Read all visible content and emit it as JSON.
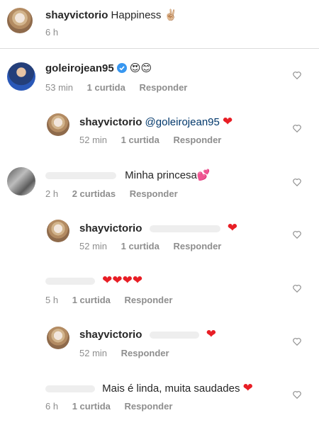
{
  "caption": {
    "username": "shayvictorio",
    "text": "Happiness",
    "emoji": "✌🏼",
    "time": "6 h"
  },
  "comments": [
    {
      "username": "goleirojean95",
      "verified": true,
      "text": "😍😊",
      "time": "53 min",
      "likes": "1 curtida",
      "reply_label": "Responder"
    },
    {
      "username": "shayvictorio",
      "mention": "@goleirojean95",
      "text": "❤",
      "time": "52 min",
      "likes": "1 curtida",
      "reply_label": "Responder"
    },
    {
      "text": "Minha princesa",
      "emoji": "💕",
      "time": "2 h",
      "likes": "2 curtidas",
      "reply_label": "Responder"
    },
    {
      "username": "shayvictorio",
      "text": "❤",
      "time": "52 min",
      "likes": "1 curtida",
      "reply_label": "Responder"
    },
    {
      "text": "❤❤❤❤",
      "time": "5 h",
      "likes": "1 curtida",
      "reply_label": "Responder"
    },
    {
      "username": "shayvictorio",
      "text": "❤",
      "time": "52 min",
      "reply_label": "Responder"
    },
    {
      "text": "Mais é linda, muita saudades",
      "emoji": "❤",
      "time": "6 h",
      "likes": "1 curtida",
      "reply_label": "Responder"
    }
  ]
}
